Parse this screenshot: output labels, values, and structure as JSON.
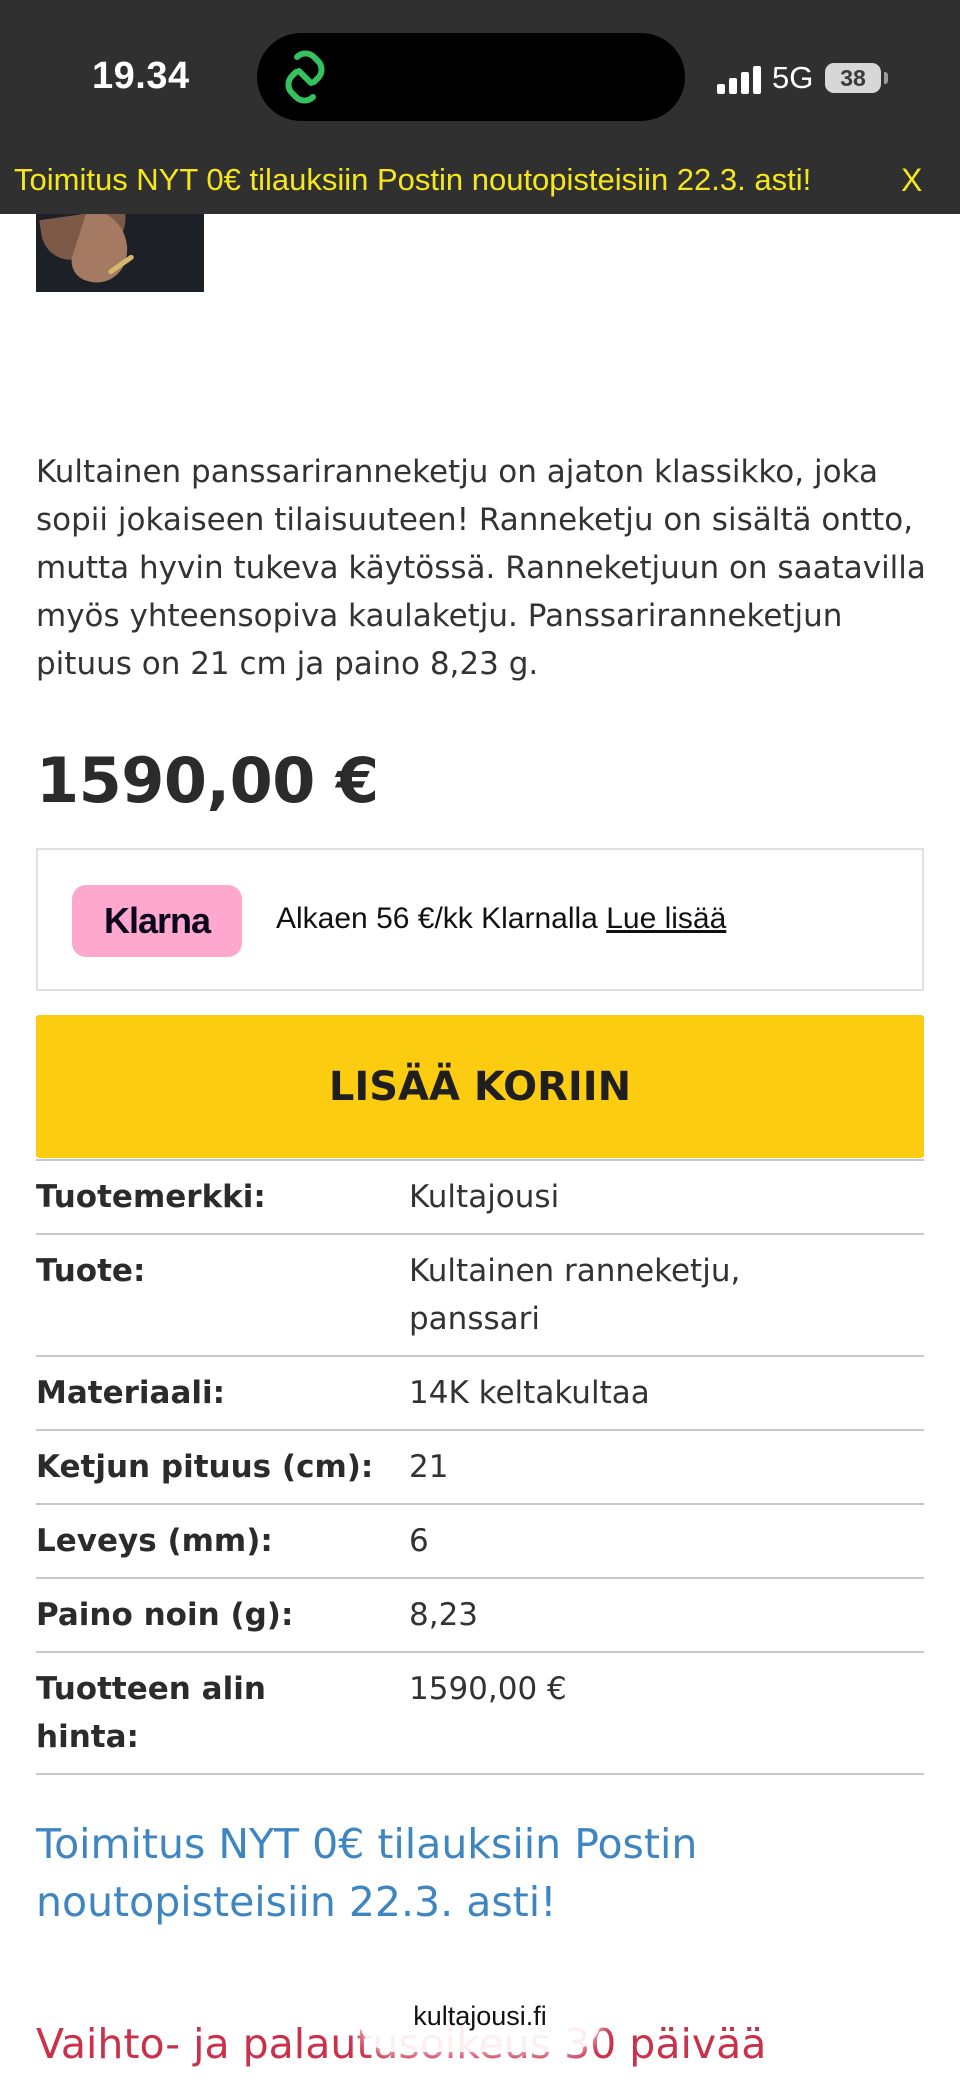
{
  "status_bar": {
    "time": "19.34",
    "network": "5G",
    "battery": "38",
    "island_app_icon": "link-icon",
    "island_icon_color": "#35c15e"
  },
  "banner": {
    "text": "Toimitus NYT 0€ tilauksiin Postin noutopisteisiin 22.3. asti!",
    "close_label": "X",
    "background": "#303030",
    "text_color": "#f5e71c"
  },
  "product": {
    "description": "Kultainen panssariranneketju on ajaton klassikko, joka sopii jokaiseen tilaisuuteen! Ranneketju on sisältä ontto, mutta hyvin tukeva käytössä. Ranneketjuun on saatavilla myös yhteensopiva kaulaketju. Panssariranneketjun pituus on 21 cm ja paino 8,23 g.",
    "price": "1590,00 €"
  },
  "klarna": {
    "logo": "Klarna",
    "text": "Alkaen 56 €/kk Klarnalla ",
    "link": "Lue lisää",
    "logo_color": "#ffa8cd"
  },
  "cart": {
    "button_label": "LISÄÄ KORIIN",
    "button_color": "#fccc10"
  },
  "specs": [
    {
      "key": "Tuotemerkki:",
      "value": "Kultajousi"
    },
    {
      "key": "Tuote:",
      "value": "Kultainen ranneketju, panssari"
    },
    {
      "key": "Materiaali:",
      "value": "14K keltakultaa"
    },
    {
      "key": "Ketjun pituus (cm):",
      "value": "21"
    },
    {
      "key": "Leveys (mm):",
      "value": "6"
    },
    {
      "key": "Paino noin (g):",
      "value": "8,23"
    },
    {
      "key": "Tuotteen alin hinta:",
      "value": "1590,00 €"
    }
  ],
  "info": {
    "shipping": "Toimitus NYT 0€ tilauksiin Postin noutopisteisiin 22.3. asti!",
    "shipping_color": "#3f86c0",
    "returns": "Vaihto- ja palautusoikeus 30 päivää",
    "returns_color": "#c9324a"
  },
  "browser": {
    "url": "kultajousi.fi"
  }
}
